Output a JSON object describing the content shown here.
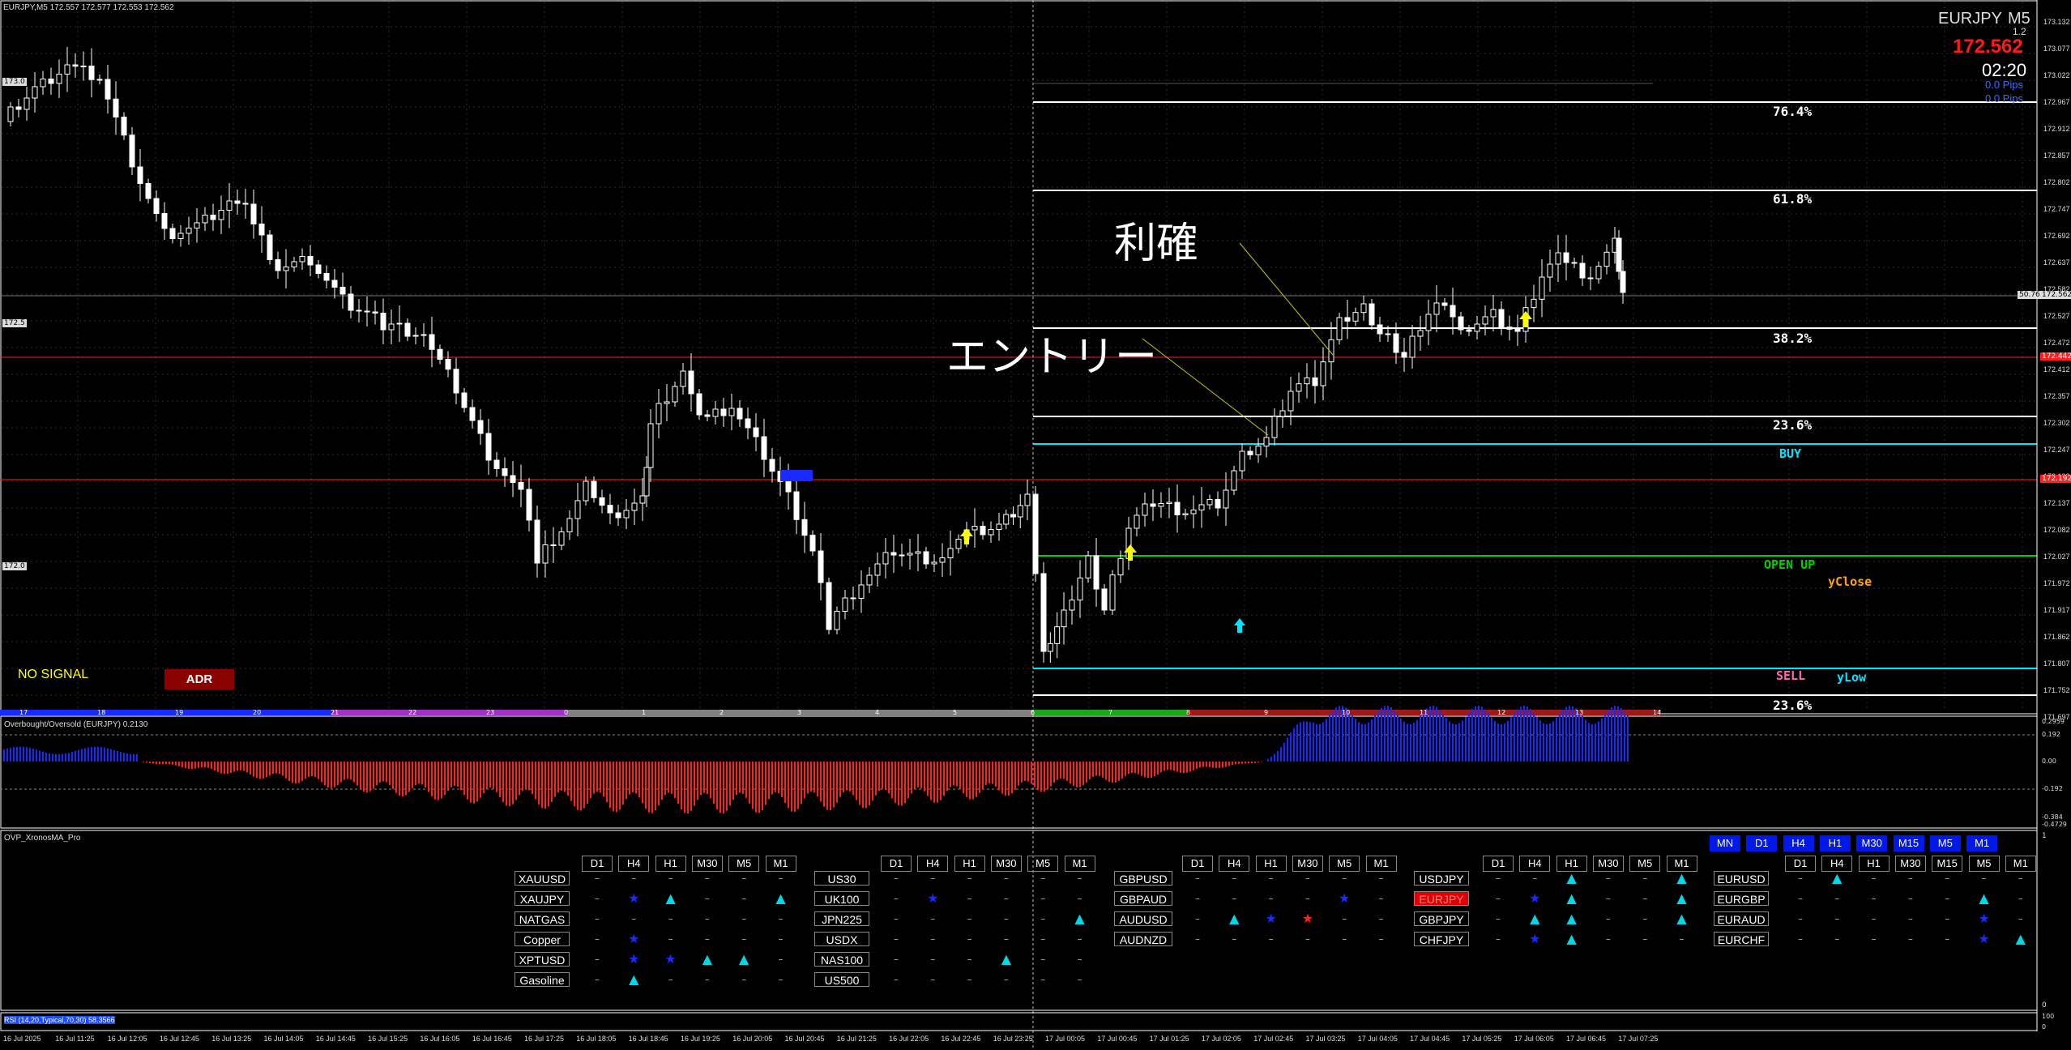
{
  "chart_header": {
    "info": "EURJPY,M5  172.557 172.577 172.553 172.562",
    "symbol": "EURJPY",
    "timeframe": "M5",
    "sub_value": "1.2",
    "price": "172.562",
    "time_left": "02:20",
    "pips1": "0.0 Pips",
    "pips2": "0.0 Pips"
  },
  "colors": {
    "bg": "#000000",
    "up_candle": "#ffffff",
    "fib_line": "#ffffff",
    "buy_line": "#00e5ff",
    "open_up_line": "#00d000",
    "red_line": "#ff2020",
    "osc_up": "#1a2aff",
    "osc_down": "#ff2020",
    "arrow_yellow": "#ffff00",
    "arrow_cyan": "#00e5ff"
  },
  "annotations": {
    "take_profit": "利確",
    "entry": "エントリー",
    "no_signal": "NO SIGNAL",
    "adr": "ADR"
  },
  "fib_levels": [
    {
      "label": "76.4%"
    },
    {
      "label": "61.8%"
    },
    {
      "label": "38.2%"
    },
    {
      "label": "23.6%"
    },
    {
      "label": "23.6%"
    }
  ],
  "level_labels": {
    "buy": "BUY",
    "open_up": "OPEN UP",
    "yclose": "yClose",
    "sell": "SELL",
    "ylow": "yLow"
  },
  "left_price_tags": [
    "173.0",
    "172.5",
    "172.0"
  ],
  "price_axis": [
    "173.132",
    "173.077",
    "173.022",
    "172.967",
    "172.912",
    "172.857",
    "172.802",
    "172.747",
    "172.692",
    "172.637",
    "172.582",
    "172.527",
    "172.472",
    "172.412",
    "172.357",
    "172.302",
    "172.247",
    "172.192",
    "172.137",
    "172.082",
    "172.027",
    "171.972",
    "171.917",
    "171.862",
    "171.807",
    "171.752",
    "171.697"
  ],
  "price_axis_tags": {
    "current": "172.562",
    "red_upper": "172.442",
    "red_lower": "172.192",
    "left_current": "50.76"
  },
  "session_labels": [
    "17",
    "18",
    "19",
    "20",
    "21",
    "22",
    "23",
    "0",
    "1",
    "2",
    "3",
    "4",
    "5",
    "6",
    "7",
    "8",
    "9",
    "10",
    "11",
    "12",
    "13",
    "14"
  ],
  "oscillator": {
    "title": "Overbought/Oversold (EURJPY) 0.2130",
    "axis": [
      "0.2959",
      "0.192",
      "0.00",
      "-0.192",
      "-0.384",
      "-0.4729"
    ]
  },
  "xronos": {
    "title": "OVP_XronosMA_Pro",
    "top_tfs": [
      "MN",
      "D1",
      "H4",
      "H1",
      "M30",
      "M15",
      "M5",
      "M1"
    ],
    "tfs6": [
      "D1",
      "H4",
      "H1",
      "M30",
      "M5",
      "M1"
    ],
    "tfs7": [
      "D1",
      "H4",
      "H1",
      "M30",
      "M15",
      "M5",
      "M1"
    ],
    "groups": [
      {
        "symbols": [
          "XAUUSD",
          "XAUJPY",
          "NATGAS",
          "Copper",
          "XPTUSD",
          "Gasoline"
        ]
      },
      {
        "symbols": [
          "US30",
          "UK100",
          "JPN225",
          "USDX",
          "NAS100",
          "US500"
        ]
      },
      {
        "symbols": [
          "GBPUSD",
          "GBPAUD",
          "AUDUSD",
          "AUDNZD"
        ]
      },
      {
        "symbols": [
          "USDJPY",
          "EURJPY",
          "GBPJPY",
          "CHFJPY"
        ]
      },
      {
        "symbols": [
          "EURUSD",
          "EURGBP",
          "EURAUD",
          "EURCHF"
        ]
      }
    ],
    "axis": [
      "1",
      "0"
    ]
  },
  "rsi": {
    "title": "RSI (14,20,Typical,70,30) 58.3566",
    "axis": [
      "100",
      "0"
    ]
  },
  "time_axis": [
    "16 Jul 2025",
    "16 Jul 11:25",
    "16 Jul 12:05",
    "16 Jul 12:45",
    "16 Jul 13:25",
    "16 Jul 14:05",
    "16 Jul 14:45",
    "16 Jul 15:25",
    "16 Jul 16:05",
    "16 Jul 16:45",
    "16 Jul 17:25",
    "16 Jul 18:05",
    "16 Jul 18:45",
    "16 Jul 19:25",
    "16 Jul 20:05",
    "16 Jul 20:45",
    "16 Jul 21:25",
    "16 Jul 22:05",
    "16 Jul 22:45",
    "16 Jul 23:25",
    "17 Jul 00:05",
    "17 Jul 00:45",
    "17 Jul 01:25",
    "17 Jul 02:05",
    "17 Jul 02:45",
    "17 Jul 03:25",
    "17 Jul 04:05",
    "17 Jul 04:45",
    "17 Jul 05:25",
    "17 Jul 06:05",
    "17 Jul 06:45",
    "17 Jul 07:25"
  ]
}
